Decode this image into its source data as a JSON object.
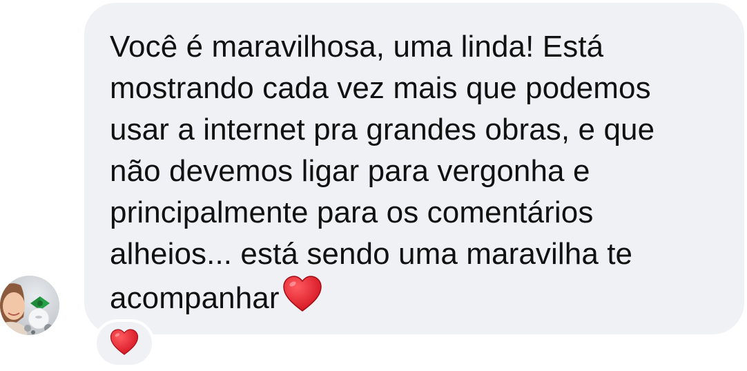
{
  "message": {
    "lines": [
      "Você é maravilhosa, uma linda! Está",
      "mostrando cada vez mais que podemos",
      "usar a internet pra grandes obras, e que",
      "não devemos ligar para vergonha e",
      "principalmente para os comentários",
      "alheios... está sendo uma maravilha te",
      "acompanhar"
    ],
    "trailing_icon": "red-heart-emoji",
    "bubble_color": "#eff1f4",
    "text_color": "#111111"
  },
  "sender": {
    "avatar_icon": "profile-photo"
  },
  "reaction": {
    "icon": "red-heart-emoji",
    "color": "#e0202c"
  }
}
